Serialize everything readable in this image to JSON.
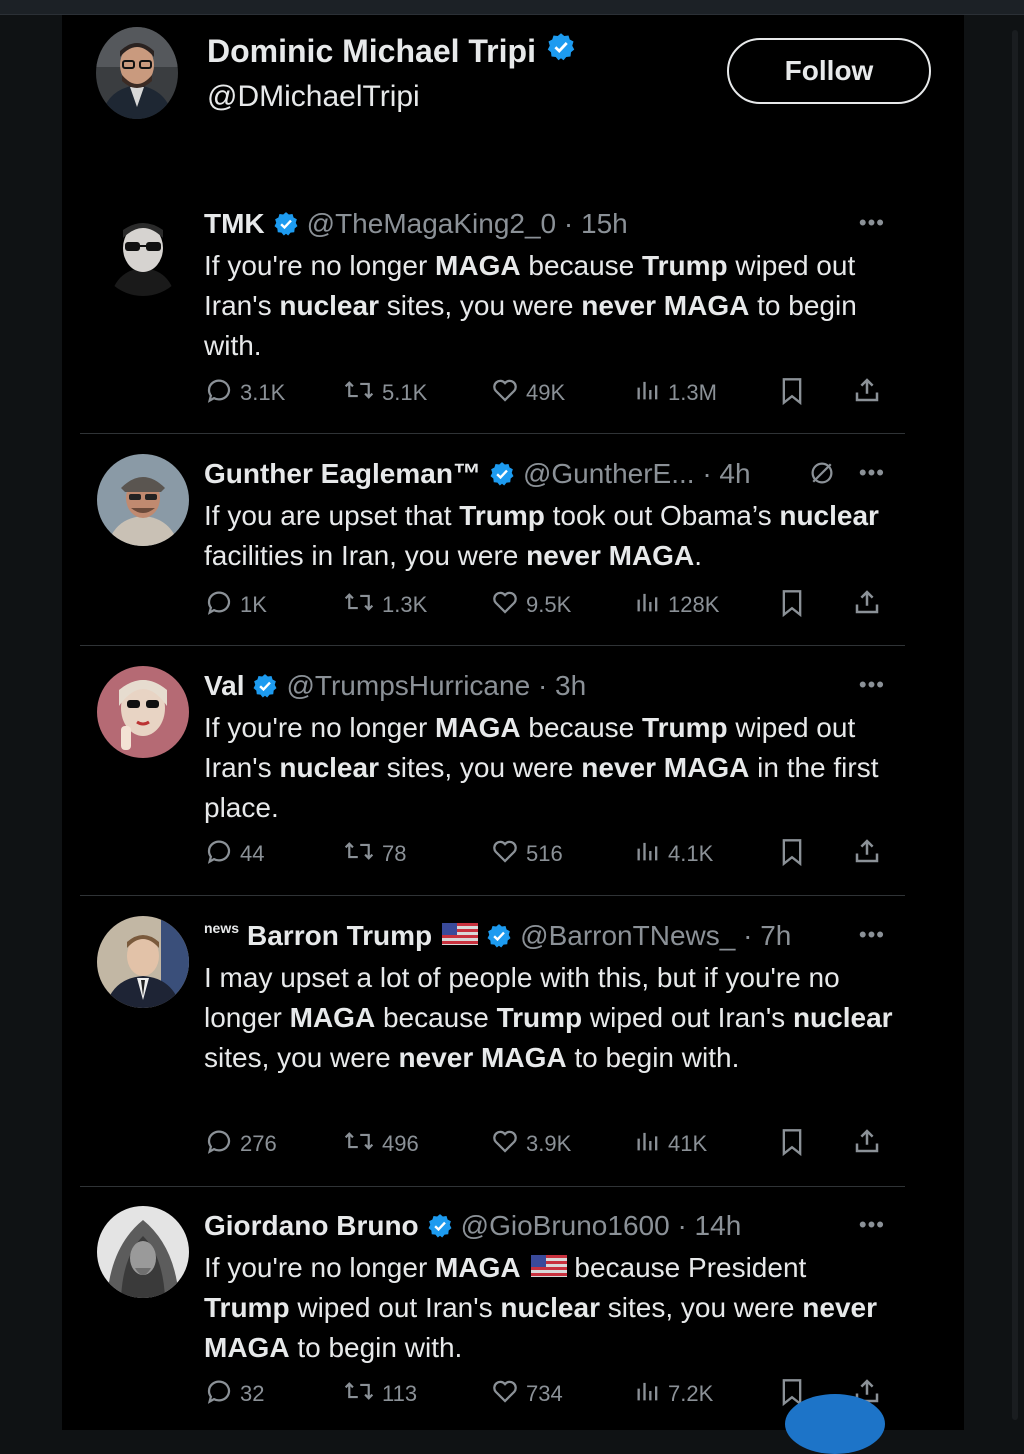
{
  "profile": {
    "name": "Dominic Michael Tripi",
    "handle": "@DMichaelTripi",
    "verified": true,
    "follow_label": "Follow"
  },
  "colors": {
    "verified_badge": "#1d9bf0",
    "muted_text": "#8b9197",
    "background": "#000000"
  },
  "icons": [
    "verified-badge-icon",
    "reply-icon",
    "retweet-icon",
    "like-icon",
    "views-icon",
    "bookmark-icon",
    "share-icon",
    "more-icon",
    "mute-icon",
    "us-flag-icon"
  ],
  "tweets": [
    {
      "prefix": "",
      "name": "TMK",
      "handle": "@TheMagaKing2_0",
      "time": "· 15h",
      "flag": false,
      "mute": false,
      "text_html": "If you're no longer <b>MAGA</b> because <b>Trump</b> wiped out Iran's <b>nuclear</b> sites, you were <b>never MAGA</b> to begin with.",
      "replies": "3.1K",
      "retweets": "5.1K",
      "likes": "49K",
      "views": "1.3M"
    },
    {
      "prefix": "",
      "name": "Gunther Eagleman™",
      "handle": "@GuntherE...",
      "time": "· 4h",
      "flag": false,
      "mute": true,
      "text_html": "If you are upset that <b>Trump</b> took out Obama’s <b>nuclear</b> facilities in Iran, you were <b>never MAGA</b>.",
      "replies": "1K",
      "retweets": "1.3K",
      "likes": "9.5K",
      "views": "128K"
    },
    {
      "prefix": "",
      "name": "Val",
      "handle": "@TrumpsHurricane",
      "time": "· 3h",
      "flag": false,
      "mute": false,
      "text_html": "If you're no longer <b>MAGA</b> because <b>Trump</b> wiped out Iran's <b>nuclear</b> sites, you were <b>never MAGA</b> in the first place.",
      "replies": "44",
      "retweets": "78",
      "likes": "516",
      "views": "4.1K"
    },
    {
      "prefix": "news",
      "name": "Barron Trump",
      "handle": "@BarronTNews_",
      "time": "· 7h",
      "flag": true,
      "mute": false,
      "text_html": "I may upset a lot of people with this, but if you're no longer <b>MAGA</b> because <b>Trump</b> wiped out Iran's <b>nuclear</b> sites, you were <b>never MAGA</b> to begin with.",
      "replies": "276",
      "retweets": "496",
      "likes": "3.9K",
      "views": "41K"
    },
    {
      "prefix": "",
      "name": "Giordano Bruno",
      "handle": "@GioBruno1600",
      "time": "· 14h",
      "flag": false,
      "mute": false,
      "text_html": "If you're no longer <b>MAGA</b><span class=\"flag\" data-name=\"us-flag-icon\" data-interactable=\"false\"><svg width=\"36\" height=\"22\" viewBox=\"0 0 36 22\"><rect width=\"36\" height=\"22\" fill=\"#d9d9d9\"/><rect y=\"0\" width=\"36\" height=\"3\" fill=\"#c8313e\"/><rect y=\"6\" width=\"36\" height=\"3\" fill=\"#c8313e\"/><rect y=\"12\" width=\"36\" height=\"3\" fill=\"#c8313e\"/><rect y=\"18\" width=\"36\" height=\"3\" fill=\"#c8313e\"/><rect width=\"15\" height=\"12\" fill=\"#3a4a9a\"/></svg></span> because President <b>Trump</b> wiped out Iran's <b>nuclear</b> sites, you were <b>never MAGA</b> to begin with.",
      "replies": "32",
      "retweets": "113",
      "likes": "734",
      "views": "7.2K"
    }
  ]
}
